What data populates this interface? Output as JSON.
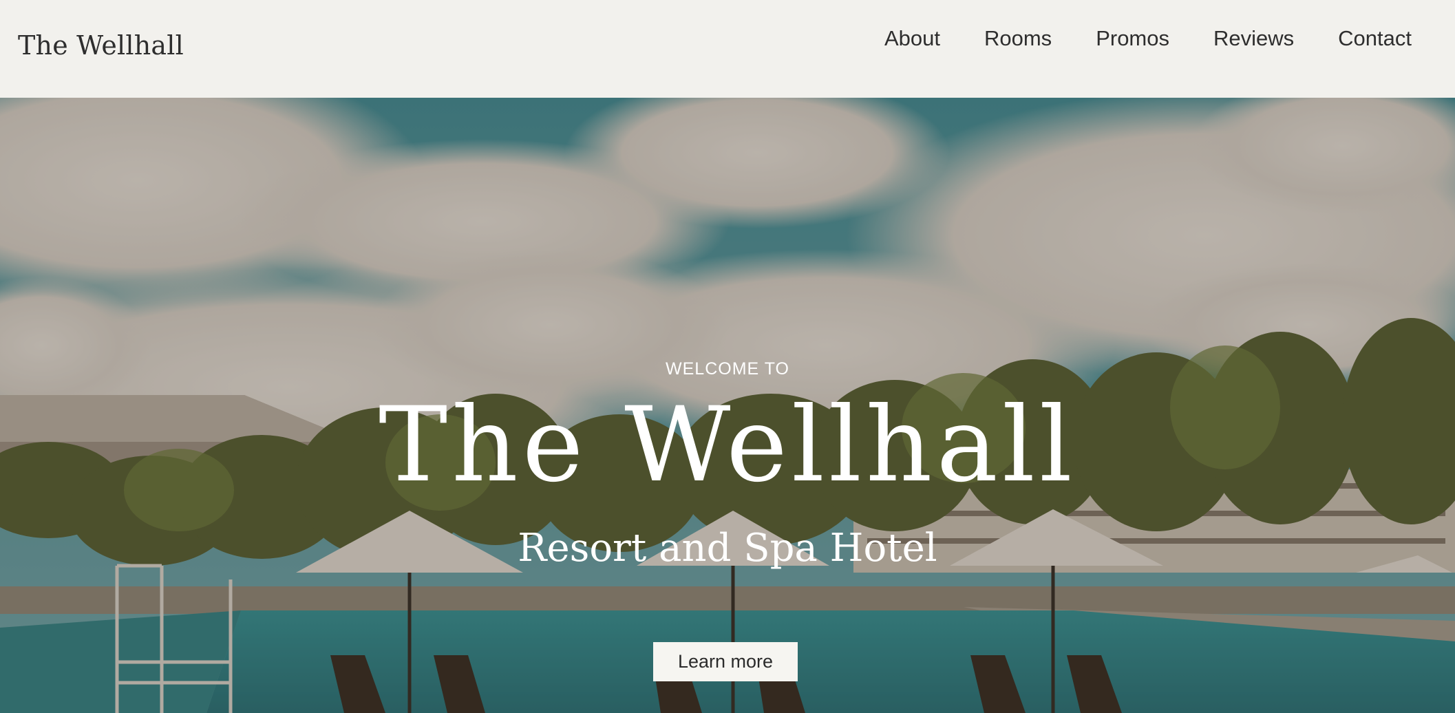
{
  "header": {
    "brand": "The Wellhall",
    "nav": [
      {
        "label": "About"
      },
      {
        "label": "Rooms"
      },
      {
        "label": "Promos"
      },
      {
        "label": "Reviews"
      },
      {
        "label": "Contact"
      }
    ]
  },
  "hero": {
    "eyebrow": "WELCOME TO",
    "title": "The Wellhall",
    "subtitle": "Resort and Spa Hotel",
    "cta_label": "Learn more",
    "image_icon": "resort-pool-photo"
  },
  "colors": {
    "header_bg": "#f2f1ed",
    "text_dark": "#2e2e2e",
    "hero_text": "#ffffff",
    "button_bg": "#f6f5f1"
  }
}
